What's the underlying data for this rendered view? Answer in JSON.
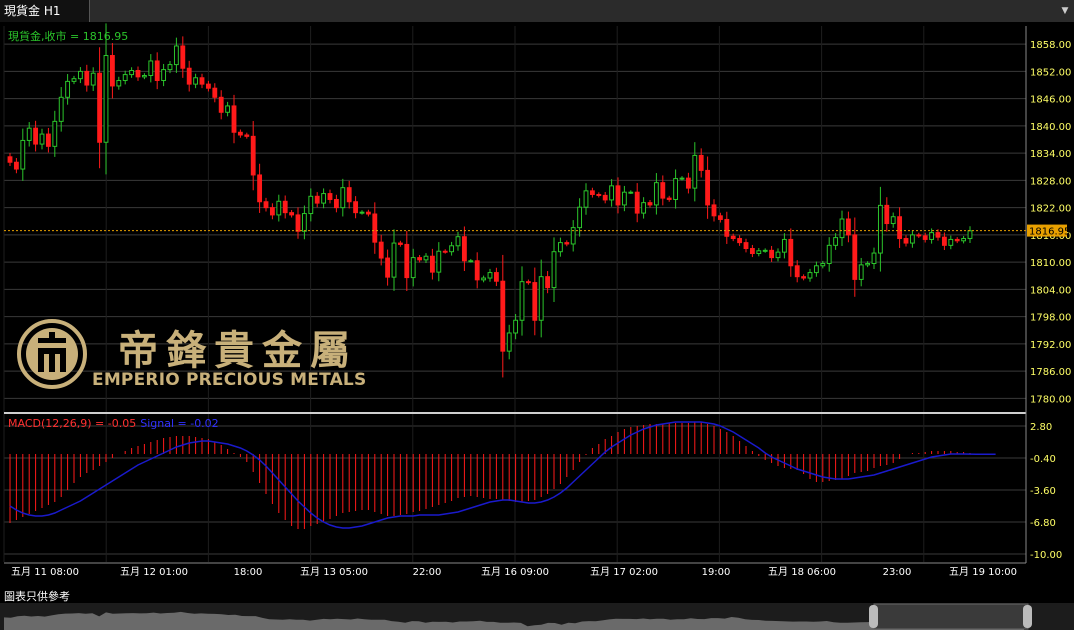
{
  "tab": {
    "title": "現貨金 H1"
  },
  "footer": {
    "note": "圖表只供參考"
  },
  "logo": {
    "cn": "帝鋒貴金屬",
    "en": "EMPERIO PRECIOUS METALS"
  },
  "colors": {
    "up": "#2bc42b",
    "down": "#ff1a1a",
    "signal": "#1a1acc",
    "price_axis_text": "#ffff66",
    "grid": "#3a3a3a",
    "current_price": "#e8a000",
    "logo": "#c8b07a"
  },
  "chart_data": [
    {
      "type": "candlestick",
      "label": "現貨金,收市 = 1816.95",
      "current_price": 1816.95,
      "ylim": [
        1777,
        1862
      ],
      "y_ticks": [
        1858.0,
        1852.0,
        1846.0,
        1840.0,
        1834.0,
        1828.0,
        1822.0,
        1816.0,
        1810.0,
        1804.0,
        1798.0,
        1792.0,
        1786.0,
        1780.0
      ],
      "x_tick_labels": [
        "五月 11 08:00",
        "五月 12 01:00",
        "18:00",
        "五月 13 05:00",
        "22:00",
        "五月 16 09:00",
        "五月 17 02:00",
        "19:00",
        "五月 18 06:00",
        "23:00",
        "五月 19 10:00"
      ],
      "close": [
        1832.0,
        1830.5,
        1836.8,
        1839.5,
        1836.0,
        1838.2,
        1835.5,
        1841.0,
        1846.3,
        1849.8,
        1850.4,
        1852.0,
        1849.0,
        1851.6,
        1836.4,
        1855.5,
        1848.8,
        1850.0,
        1851.3,
        1852.2,
        1850.8,
        1851.1,
        1854.3,
        1850.0,
        1852.4,
        1853.5,
        1857.6,
        1852.7,
        1849.2,
        1850.6,
        1849.2,
        1848.3,
        1846.3,
        1843.0,
        1844.4,
        1838.6,
        1838.0,
        1837.7,
        1829.2,
        1823.3,
        1822.0,
        1820.4,
        1823.4,
        1820.9,
        1820.4,
        1816.8,
        1820.7,
        1824.5,
        1823.0,
        1825.1,
        1823.8,
        1822.0,
        1826.4,
        1823.3,
        1820.9,
        1821.0,
        1820.6,
        1814.4,
        1810.9,
        1806.7,
        1814.2,
        1813.9,
        1806.6,
        1811.0,
        1810.5,
        1811.3,
        1807.8,
        1812.4,
        1812.3,
        1813.6,
        1815.6,
        1810.3,
        1810.3,
        1806.1,
        1806.5,
        1807.7,
        1805.8,
        1790.4,
        1794.4,
        1797.2,
        1805.7,
        1805.5,
        1797.2,
        1806.8,
        1804.4,
        1812.3,
        1814.3,
        1814.0,
        1817.6,
        1822.1,
        1825.7,
        1824.9,
        1824.7,
        1823.7,
        1826.8,
        1822.6,
        1825.4,
        1825.4,
        1820.8,
        1823.1,
        1822.6,
        1827.5,
        1824.1,
        1823.8,
        1828.4,
        1828.5,
        1826.3,
        1833.5,
        1830.2,
        1822.6,
        1820.2,
        1819.4,
        1815.7,
        1815.2,
        1814.3,
        1813.0,
        1811.9,
        1812.5,
        1812.6,
        1811.0,
        1812.2,
        1815.0,
        1809.2,
        1806.8,
        1806.5,
        1807.7,
        1809.2,
        1809.7,
        1813.7,
        1815.4,
        1819.5,
        1816.0,
        1806.2,
        1809.4,
        1809.7,
        1812.0,
        1822.5,
        1818.5,
        1820.0,
        1815.2,
        1814.2,
        1816.0,
        1815.8,
        1815.0,
        1816.5,
        1815.5,
        1813.7,
        1815.0,
        1814.7,
        1815.2,
        1816.9
      ]
    },
    {
      "type": "bar",
      "label": "MACD(12,26,9) = -0.05",
      "signal_label": "Signal = -0.02",
      "ylim": [
        -10.8,
        3.8
      ],
      "y_ticks": [
        2.8,
        -0.4,
        -3.6,
        -6.8,
        -10.0
      ],
      "macd": [
        -6.9,
        -6.6,
        -6.3,
        -6.0,
        -5.7,
        -5.4,
        -5.1,
        -4.8,
        -4.3,
        -3.6,
        -2.9,
        -2.3,
        -1.9,
        -1.6,
        -1.2,
        -0.8,
        -0.4,
        0.0,
        0.3,
        0.6,
        0.8,
        1.0,
        1.2,
        1.4,
        1.6,
        1.7,
        1.8,
        1.8,
        1.8,
        1.7,
        1.6,
        1.5,
        1.2,
        0.9,
        0.5,
        0.1,
        -0.3,
        -0.8,
        -1.8,
        -2.9,
        -4.0,
        -5.0,
        -5.9,
        -6.6,
        -7.2,
        -7.5,
        -7.5,
        -7.2,
        -7.0,
        -6.8,
        -6.5,
        -6.2,
        -5.9,
        -5.8,
        -5.7,
        -5.6,
        -5.6,
        -5.8,
        -6.0,
        -6.2,
        -6.2,
        -6.1,
        -6.0,
        -5.8,
        -5.7,
        -5.5,
        -5.3,
        -5.1,
        -4.9,
        -4.7,
        -4.4,
        -4.3,
        -4.2,
        -4.3,
        -4.4,
        -4.5,
        -4.5,
        -4.6,
        -4.7,
        -4.8,
        -4.8,
        -4.7,
        -4.6,
        -4.3,
        -4.0,
        -3.5,
        -3.0,
        -2.3,
        -1.6,
        -0.8,
        -0.1,
        0.6,
        1.0,
        1.5,
        1.8,
        2.2,
        2.5,
        2.7,
        2.8,
        2.9,
        3.0,
        3.0,
        3.0,
        3.1,
        3.1,
        3.1,
        3.1,
        3.2,
        3.2,
        3.0,
        2.8,
        2.5,
        2.2,
        1.8,
        1.3,
        0.8,
        0.3,
        -0.2,
        -0.6,
        -0.9,
        -1.2,
        -1.4,
        -1.5,
        -1.6,
        -2.0,
        -2.5,
        -2.8,
        -2.8,
        -2.7,
        -2.6,
        -2.5,
        -2.2,
        -1.9,
        -1.8,
        -1.7,
        -1.4,
        -1.2,
        -1.1,
        -0.9,
        -0.5,
        0.0,
        0.1,
        0.1,
        0.2,
        0.3,
        0.3,
        0.3,
        0.3,
        0.2,
        0.2,
        0.1,
        0.0,
        -0.05
      ],
      "signal": [
        -5.2,
        -5.6,
        -5.9,
        -6.1,
        -6.2,
        -6.2,
        -6.1,
        -5.9,
        -5.6,
        -5.3,
        -5.0,
        -4.7,
        -4.3,
        -3.9,
        -3.5,
        -3.1,
        -2.7,
        -2.3,
        -1.9,
        -1.5,
        -1.1,
        -0.8,
        -0.5,
        -0.2,
        0.1,
        0.4,
        0.7,
        0.9,
        1.1,
        1.2,
        1.3,
        1.3,
        1.2,
        1.1,
        1.0,
        0.8,
        0.6,
        0.3,
        -0.1,
        -0.6,
        -1.2,
        -1.9,
        -2.6,
        -3.3,
        -4.0,
        -4.7,
        -5.3,
        -5.9,
        -6.4,
        -6.8,
        -7.1,
        -7.3,
        -7.4,
        -7.4,
        -7.3,
        -7.2,
        -7.0,
        -6.8,
        -6.6,
        -6.4,
        -6.3,
        -6.2,
        -6.2,
        -6.2,
        -6.1,
        -6.1,
        -6.1,
        -6.1,
        -6.0,
        -5.9,
        -5.8,
        -5.6,
        -5.4,
        -5.2,
        -5.0,
        -4.8,
        -4.7,
        -4.6,
        -4.6,
        -4.7,
        -4.8,
        -4.9,
        -4.9,
        -4.8,
        -4.6,
        -4.3,
        -3.9,
        -3.4,
        -2.8,
        -2.2,
        -1.6,
        -1.0,
        -0.4,
        0.2,
        0.7,
        1.1,
        1.5,
        1.9,
        2.2,
        2.5,
        2.7,
        2.9,
        3.0,
        3.1,
        3.2,
        3.2,
        3.2,
        3.2,
        3.2,
        3.1,
        3.0,
        2.8,
        2.5,
        2.2,
        1.8,
        1.4,
        1.0,
        0.6,
        0.1,
        -0.3,
        -0.6,
        -0.9,
        -1.2,
        -1.5,
        -1.7,
        -1.9,
        -2.1,
        -2.3,
        -2.4,
        -2.5,
        -2.5,
        -2.5,
        -2.4,
        -2.3,
        -2.2,
        -2.1,
        -1.9,
        -1.7,
        -1.5,
        -1.3,
        -1.1,
        -0.9,
        -0.7,
        -0.5,
        -0.3,
        -0.2,
        -0.1,
        0.0,
        0.0,
        0.0,
        -0.01,
        -0.02,
        -0.02,
        -0.02,
        -0.02
      ]
    }
  ]
}
